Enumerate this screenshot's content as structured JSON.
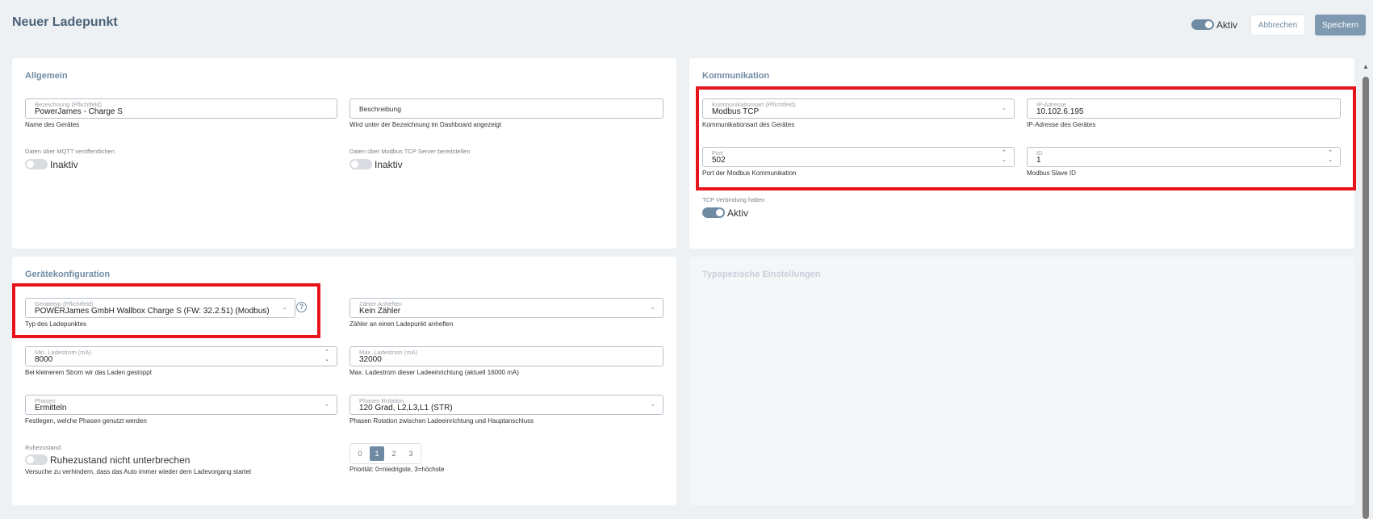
{
  "page": {
    "title": "Neuer Ladepunkt"
  },
  "header": {
    "active_label": "Aktiv",
    "cancel_label": "Abbrechen",
    "save_label": "Speichern"
  },
  "general": {
    "title": "Allgemein",
    "name": {
      "label": "Bezeichnung (Pflichtfeld)",
      "value": "PowerJames - Charge S",
      "help": "Name des Gerätes"
    },
    "description": {
      "label": "Beschreibung",
      "help": "Wird unter der Bezeichnung im Dashboard angezeigt"
    },
    "mqtt": {
      "label": "Daten über MQTT veröffentlichen",
      "state": "Inaktiv"
    },
    "modbus_server": {
      "label": "Daten über Modbus TCP Server bereitstellen",
      "state": "Inaktiv"
    }
  },
  "communication": {
    "title": "Kommunikation",
    "type": {
      "label": "Kommunikationsart (Pflichtfeld)",
      "value": "Modbus TCP",
      "help": "Kommunikationsart des Gerätes"
    },
    "ip": {
      "label": "IP-Adresse",
      "value": "10.102.6.195",
      "help": "IP-Adresse des Gerätes"
    },
    "port": {
      "label": "Port",
      "value": "502",
      "help": "Port der Modbus Kommunikation"
    },
    "id": {
      "label": "ID",
      "value": "1",
      "help": "Modbus Slave ID"
    },
    "keep_tcp": {
      "label": "TCP Verbindung halten",
      "state": "Aktiv"
    }
  },
  "device_config": {
    "title": "Gerätekonfiguration",
    "device_type": {
      "label": "Gerätetyp (Pflichtfeld)",
      "value": "POWERJames GmbH Wallbox Charge S (FW: 32.2.51) (Modbus)",
      "help": "Typ des Ladepunktes"
    },
    "meter": {
      "label": "Zähler Anheften",
      "value": "Kein Zähler",
      "help": "Zähler an einen Ladepunkt anheften"
    },
    "min_current": {
      "label": "Min. Ladestrom (mA)",
      "value": "8000",
      "help": "Bei kleinerem Strom wir das Laden gestoppt"
    },
    "max_current": {
      "label": "Max. Ladestrom (mA)",
      "value": "32000",
      "help": "Max. Ladestrom dieser Ladeeinrichtung (aktuell 16000 mA)"
    },
    "phases": {
      "label": "Phasen",
      "value": "Ermitteln",
      "help": "Festlegen, welche Phasen genutzt werden"
    },
    "phase_rotation": {
      "label": "Phasen Rotation",
      "value": "120 Grad, L2,L3,L1 (STR)",
      "help": "Phasen Rotation zwischen Ladeeinrichtung und Hauptanschluss"
    },
    "idle": {
      "label": "Ruhezustand",
      "state": "Ruhezustand nicht unterbrechen",
      "help": "Versuche zu verhindern, dass das Auto immer wieder dem Ladevorgang startet"
    },
    "priority": {
      "options": [
        "0",
        "1",
        "2",
        "3"
      ],
      "selected": "1",
      "help": "Priorität: 0=niedrigste, 3=höchste"
    }
  },
  "type_settings": {
    "title": "Typspezische Einstellungen"
  },
  "icons": {
    "chevron": "chevron-down-icon",
    "spinner": "spinner-arrows-icon",
    "help": "question-circle-icon",
    "scroll_up": "scroll-up-icon"
  }
}
